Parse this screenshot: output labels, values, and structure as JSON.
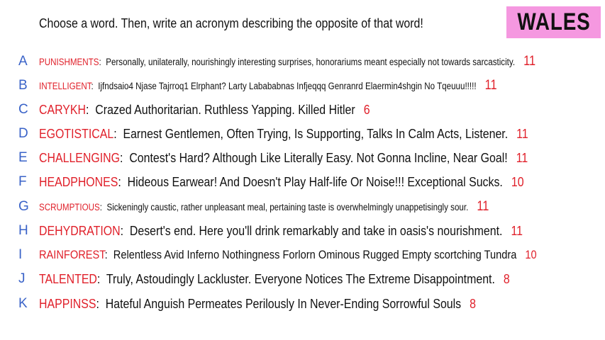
{
  "header": {
    "instruction": "Choose a word. Then, write an acronym describing the opposite of that word!",
    "badge": "WALES"
  },
  "entries": [
    {
      "letter": "A",
      "word": "PUNISHMENTS",
      "acronym": "Personally, unilaterally, nourishingly interesting surprises, honorariums meant especially not towards sarcasticity.",
      "score": "11"
    },
    {
      "letter": "B",
      "word": "INTELLIGENT",
      "acronym": "Ijfndsaio4 Njase Tajrroq1 Elrphant? Larty Labababnas Infjeqqq Genranrd Elaermin4shgin No Tqeuuu!!!!!",
      "score": "11"
    },
    {
      "letter": "C",
      "word": "CARYKH",
      "acronym": "Crazed Authoritarian. Ruthless Yapping. Killed Hitler",
      "score": "6"
    },
    {
      "letter": "D",
      "word": "EGOTISTICAL",
      "acronym": "Earnest Gentlemen, Often Trying, Is Supporting, Talks In Calm Acts, Listener.",
      "score": "11"
    },
    {
      "letter": "E",
      "word": "CHALLENGING",
      "acronym": "Contest's Hard? Although Like Literally Easy. Not Gonna Incline, Near Goal!",
      "score": "11"
    },
    {
      "letter": "F",
      "word": "HEADPHONES",
      "acronym": "Hideous Earwear! And Doesn't Play Half-life Or Noise!!! Exceptional Sucks.",
      "score": "10"
    },
    {
      "letter": "G",
      "word": "SCRUMPTIOUS",
      "acronym": "Sickeningly caustic, rather  unpleasant  meal, pertaining  taste is overwhelmingly unappetisingly sour.",
      "score": "11"
    },
    {
      "letter": "H",
      "word": "DEHYDRATION",
      "acronym": "Desert's end. Here you'll drink remarkably and take in oasis's nourishment.",
      "score": "11"
    },
    {
      "letter": "I",
      "word": "RAINFOREST",
      "acronym": "Relentless Avid Inferno Nothingness Forlorn Ominous Rugged Empty scortching Tundra",
      "score": "10"
    },
    {
      "letter": "J",
      "word": "TALENTED",
      "acronym": "Truly, Astoudingly Lackluster. Everyone Notices The Extreme Disappointment.",
      "score": "8"
    },
    {
      "letter": "K",
      "word": "HAPPINSS",
      "acronym": "Hateful Anguish Permeates Perilously In Never-Ending Sorrowful Souls",
      "score": "8"
    }
  ]
}
